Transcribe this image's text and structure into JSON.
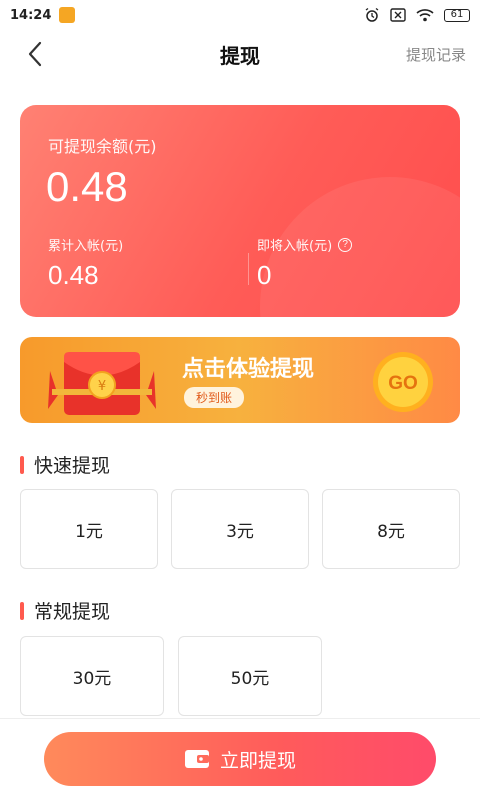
{
  "status_bar": {
    "time": "14:24",
    "battery": "61"
  },
  "nav": {
    "title": "提现",
    "right_link": "提现记录"
  },
  "balance": {
    "label": "可提现余额(元)",
    "value": "0.48",
    "total_label": "累计入帐(元)",
    "total_value": "0.48",
    "pending_label": "即将入帐(元)",
    "pending_value": "0",
    "help_icon_char": "?"
  },
  "promo": {
    "title": "点击体验提现",
    "tag": "秒到账",
    "go_label": "GO",
    "packet_symbol": "¥"
  },
  "fast_section": {
    "title": "快速提现",
    "options": [
      "1元",
      "3元",
      "8元"
    ]
  },
  "regular_section": {
    "title": "常规提现",
    "options": [
      "30元",
      "50元"
    ]
  },
  "withdraw_button": {
    "label": "立即提现"
  },
  "colors": {
    "accent": "#ff5a4e",
    "promo": "#f7a838"
  }
}
